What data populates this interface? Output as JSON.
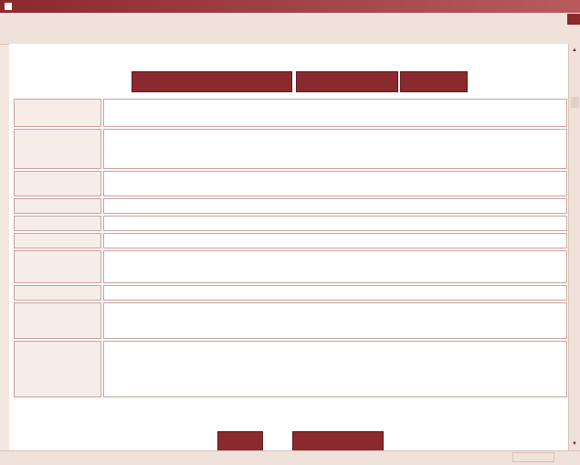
{
  "window": {
    "title": "",
    "controls": ""
  },
  "menubar": {
    "items": [
      "",
      "",
      "",
      "",
      "",
      ""
    ]
  },
  "toolbar": {
    "items": [
      "",
      "",
      "",
      "",
      "",
      "",
      ""
    ],
    "links_label": ""
  },
  "buttons": {
    "back_to_results": "",
    "further_documents": "",
    "new_query": "",
    "help": "",
    "next": ""
  },
  "table": {
    "rows": [
      {
        "label": "",
        "lines": [
          ""
        ]
      },
      {
        "label": "",
        "lines": [
          "",
          ""
        ]
      },
      {
        "label": "",
        "lines": [
          "",
          ""
        ]
      },
      {
        "label": "",
        "lines": [
          ""
        ]
      },
      {
        "label": "",
        "lines": [
          ""
        ]
      },
      {
        "label": "",
        "lines": [
          ""
        ]
      },
      {
        "label": "",
        "lines": [
          "",
          "",
          ""
        ]
      },
      {
        "label": "",
        "lines": [
          ""
        ]
      },
      {
        "label": "",
        "lines": [
          "",
          ""
        ]
      },
      {
        "label": "",
        "lines": [
          "",
          "",
          ""
        ]
      }
    ]
  },
  "statusbar": {
    "done": "",
    "zone": ""
  },
  "colors": {
    "accent": "#8b2a2e",
    "background": "#f3e7e0",
    "border": "#c9a29e"
  }
}
